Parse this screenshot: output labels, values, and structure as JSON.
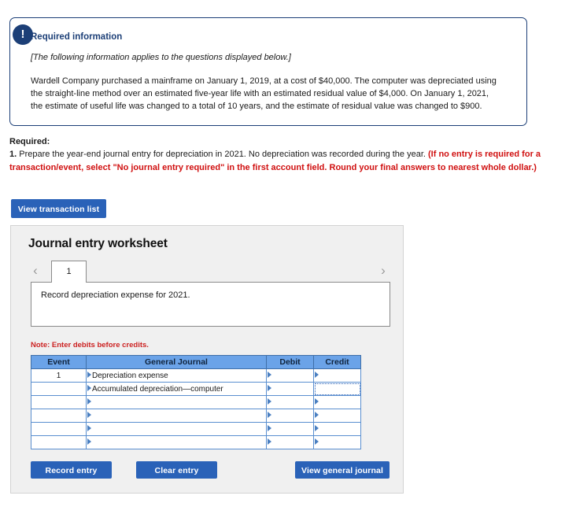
{
  "callout": {
    "badge_icon": "exclamation-icon",
    "heading": "Required information",
    "applies_note": "[The following information applies to the questions displayed below.]",
    "body": "Wardell Company purchased a mainframe on January 1, 2019, at a cost of $40,000. The computer was depreciated using the straight-line method over an estimated five-year life with an estimated residual value of $4,000. On January 1, 2021, the estimate of useful life was changed to a total of 10 years, and the estimate of residual value was changed to $900.",
    "border_color": "#1c3f77",
    "heading_color": "#1c3f77"
  },
  "required": {
    "label": "Required:",
    "item_number": "1.",
    "normal_text": " Prepare the year-end journal entry for depreciation in 2021. No depreciation was recorded during the year. ",
    "red_text": "(If no entry is required for a transaction/event, select \"No journal entry required\" in the first account field. Round your final answers to nearest whole dollar.)",
    "red_color": "#d01010"
  },
  "buttons": {
    "view_transaction_list": "View transaction list",
    "record_entry": "Record entry",
    "clear_entry": "Clear entry",
    "view_general_journal": "View general journal",
    "primary_color": "#2a62b8"
  },
  "worksheet": {
    "title": "Journal entry worksheet",
    "tabs": {
      "prev_icon": "chevron-left-icon",
      "next_icon": "chevron-right-icon",
      "items": [
        {
          "label": "1",
          "active": true
        }
      ]
    },
    "instruction": "Record depreciation expense for 2021.",
    "note": "Note: Enter debits before credits.",
    "note_color": "#cc2222",
    "header_bg": "#6ba3e8"
  },
  "journal_table": {
    "columns": [
      "Event",
      "General Journal",
      "Debit",
      "Credit"
    ],
    "rows": [
      {
        "event": "1",
        "account": "Depreciation expense",
        "debit": "",
        "credit": "",
        "credit_focused": false
      },
      {
        "event": "",
        "account": "Accumulated depreciation—computer",
        "debit": "",
        "credit": "",
        "credit_focused": true
      },
      {
        "event": "",
        "account": "",
        "debit": "",
        "credit": "",
        "credit_focused": false
      },
      {
        "event": "",
        "account": "",
        "debit": "",
        "credit": "",
        "credit_focused": false
      },
      {
        "event": "",
        "account": "",
        "debit": "",
        "credit": "",
        "credit_focused": false
      },
      {
        "event": "",
        "account": "",
        "debit": "",
        "credit": "",
        "credit_focused": false
      }
    ]
  }
}
